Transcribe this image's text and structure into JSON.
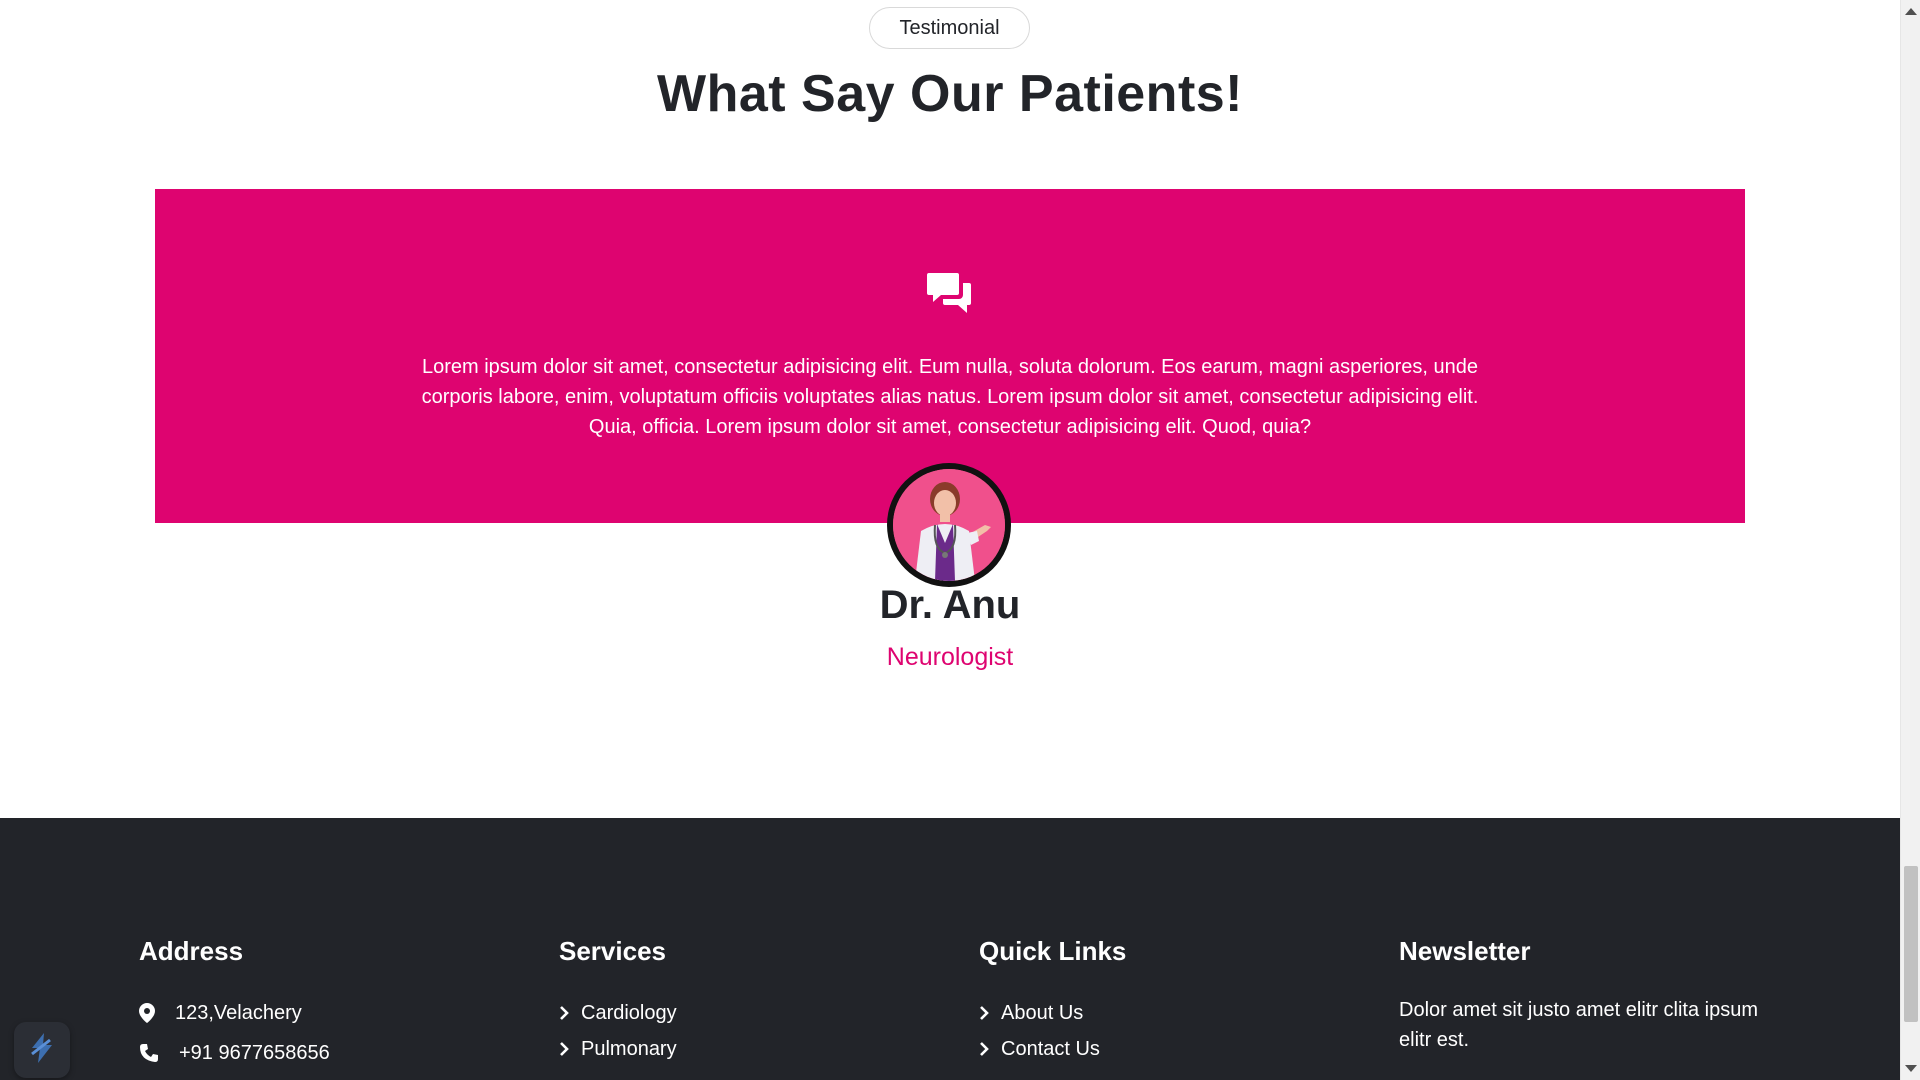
{
  "testimonial": {
    "tag": "Testimonial",
    "title": "What Say Our Patients!",
    "quote_icon": "chat-bubbles-icon",
    "text": "Lorem ipsum dolor sit amet, consectetur adipisicing elit. Eum nulla, soluta dolorum. Eos earum, magni asperiores, unde corporis labore, enim, voluptatum officiis voluptates alias natus. Lorem ipsum dolor sit amet, consectetur adipisicing elit. Quia, officia. Lorem ipsum dolor sit amet, consectetur adipisicing elit. Quod, quia?",
    "person": {
      "name": "Dr. Anu",
      "role": "Neurologist"
    }
  },
  "footer": {
    "address": {
      "heading": "Address",
      "items": [
        {
          "icon": "map-pin-icon",
          "text": "123,Velachery"
        },
        {
          "icon": "phone-icon",
          "text": "+91 9677658656"
        }
      ]
    },
    "services": {
      "heading": "Services",
      "items": [
        "Cardiology",
        "Pulmonary"
      ]
    },
    "quick_links": {
      "heading": "Quick Links",
      "items": [
        "About Us",
        "Contact Us"
      ]
    },
    "newsletter": {
      "heading": "Newsletter",
      "text": "Dolor amet sit justo amet elitr clita ipsum elitr est."
    }
  },
  "colors": {
    "accent": "#de0470",
    "dark": "#222429",
    "white": "#ffffff"
  }
}
